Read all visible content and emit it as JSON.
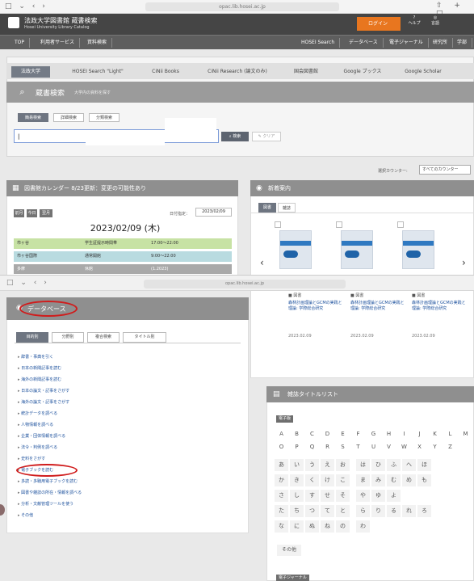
{
  "browser": {
    "url": "opac.lib.hosei.ac.jp",
    "controls": "□ ⌄ ‹ ›",
    "actions": "⇧ + □"
  },
  "overlay_browser": {
    "url": "opac.lib.hosei.ac.jp",
    "controls": "□ ⌄ ‹ ›"
  },
  "header": {
    "title": "法政大学図書館 蔵書検索",
    "subtitle": "Hosei University Library Catalog",
    "login_label": "ログイン",
    "icons": [
      {
        "name": "help-icon",
        "label": "ヘルプ"
      },
      {
        "name": "language-icon",
        "label": "言語"
      }
    ]
  },
  "main_nav": [
    "TOP",
    "利用者サービス",
    "資料検索",
    "HOSEI Search",
    "データベース",
    "電子ジャーナル",
    "研究所",
    "学部"
  ],
  "db_tabs": [
    "法政大学",
    "HOSEI Search \"Light\"",
    "CiNii Books",
    "CiNii Research (論文のみ)",
    "国会図書館",
    "Google ブックス",
    "Google Scholar"
  ],
  "search": {
    "title": "蔵書検索",
    "subtitle": "大学内の資料を探す",
    "modes": [
      "簡易検索",
      "詳細検索",
      "分類検索"
    ],
    "value": "|",
    "search_label": "検索",
    "clear_label": "クリア"
  },
  "counter": {
    "label": "選択カウンター:",
    "value": "すべてのカウンター"
  },
  "calendar": {
    "title": "図書館カレンダー 8/23更新：変更の可能性あり",
    "nav": [
      "前月",
      "今日",
      "翌月"
    ],
    "date_label": "日付指定：",
    "date_value": "2023/02/09",
    "date_big": "2023/02/09 (木)",
    "rows": [
      {
        "place": "市ヶ谷",
        "note": "学生証提示時間帯",
        "hours": "17:00〜22:00"
      },
      {
        "place": "市ヶ谷国際",
        "note": "通常開館",
        "hours": "9:00〜22:00"
      },
      {
        "place": "多摩",
        "note": "休館",
        "hours": "(1.2023)"
      }
    ]
  },
  "new_books": {
    "title": "新着案内",
    "tabs": [
      "図書",
      "雑誌"
    ],
    "items": [
      {
        "category": "図書",
        "title": "森林計画理論とGCMの実践と理論: 学際総合研究",
        "date": "2023.02.09"
      },
      {
        "category": "図書",
        "title": "森林計画理論とGCMの実践と理論: 学際総合研究",
        "date": "2023.02.09"
      },
      {
        "category": "図書",
        "title": "森林計画理論とGCMの実践と理論: 学際総合研究",
        "date": "2023.02.09"
      }
    ]
  },
  "database": {
    "title": "データベース",
    "subtabs": [
      "目的別",
      "分野別",
      "複合検索",
      "タイトル別"
    ],
    "links": [
      "辞書・事典を引く",
      "日本の新聞記事を読む",
      "海外の新聞記事を読む",
      "日本の論文・記事をさがす",
      "海外の論文・記事をさがす",
      "統計データを調べる",
      "人物情報を調べる",
      "企業・団体情報を調べる",
      "法令・判例を調べる",
      "史料をさがす",
      "電子ブックを読む",
      "多読・多聴用電子ブックを読む",
      "図書や雑誌の所在・情報を調べる",
      "分析・文献管理ツールを使う",
      "その他"
    ]
  },
  "magazine": {
    "title": "雑誌タイトルリスト",
    "badge": "電子版",
    "letters_row1": [
      "A",
      "B",
      "C",
      "D",
      "E",
      "F",
      "G",
      "H",
      "I",
      "J",
      "K",
      "L",
      "M"
    ],
    "letters_row2": [
      "O",
      "P",
      "Q",
      "R",
      "S",
      "T",
      "U",
      "V",
      "W",
      "X",
      "Y",
      "Z"
    ],
    "kana_rows": [
      [
        "あ",
        "い",
        "う",
        "え",
        "お",
        "は",
        "ひ",
        "ふ",
        "へ",
        "ほ"
      ],
      [
        "か",
        "き",
        "く",
        "け",
        "こ",
        "ま",
        "み",
        "む",
        "め",
        "も"
      ],
      [
        "さ",
        "し",
        "す",
        "せ",
        "そ",
        "や",
        "ゆ",
        "よ"
      ],
      [
        "た",
        "ち",
        "つ",
        "て",
        "と",
        "ら",
        "り",
        "る",
        "れ",
        "ろ"
      ],
      [
        "な",
        "に",
        "ぬ",
        "ね",
        "の",
        "わ"
      ]
    ],
    "other_label": "その他",
    "bottom_badge": "電子ジャーナル"
  }
}
